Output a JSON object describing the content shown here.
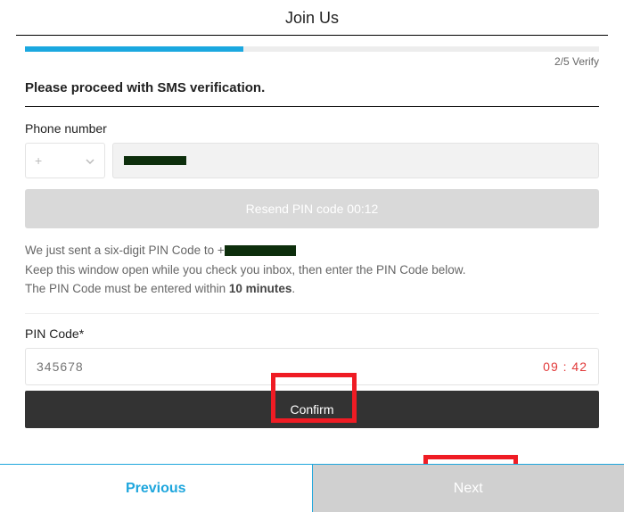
{
  "page": {
    "title": "Join Us",
    "step_current": "2",
    "step_total": "5",
    "step_name": "Verify",
    "step_indicator": "2/5 Verify"
  },
  "heading": "Please proceed with SMS verification.",
  "phone": {
    "label": "Phone number",
    "cc_prefix": "+",
    "resend_label": "Resend PIN code 00:12"
  },
  "info": {
    "line1_prefix": "We just sent a six-digit PIN Code to +",
    "line2": "Keep this window open while you check you inbox, then enter the PIN Code below.",
    "line3_prefix": "The PIN Code must be entered within ",
    "line3_bold": "10 minutes",
    "line3_suffix": "."
  },
  "pin": {
    "label": "PIN Code*",
    "placeholder": "345678",
    "timer": "09 : 42",
    "confirm_label": "Confirm"
  },
  "footer": {
    "previous": "Previous",
    "next": "Next"
  }
}
